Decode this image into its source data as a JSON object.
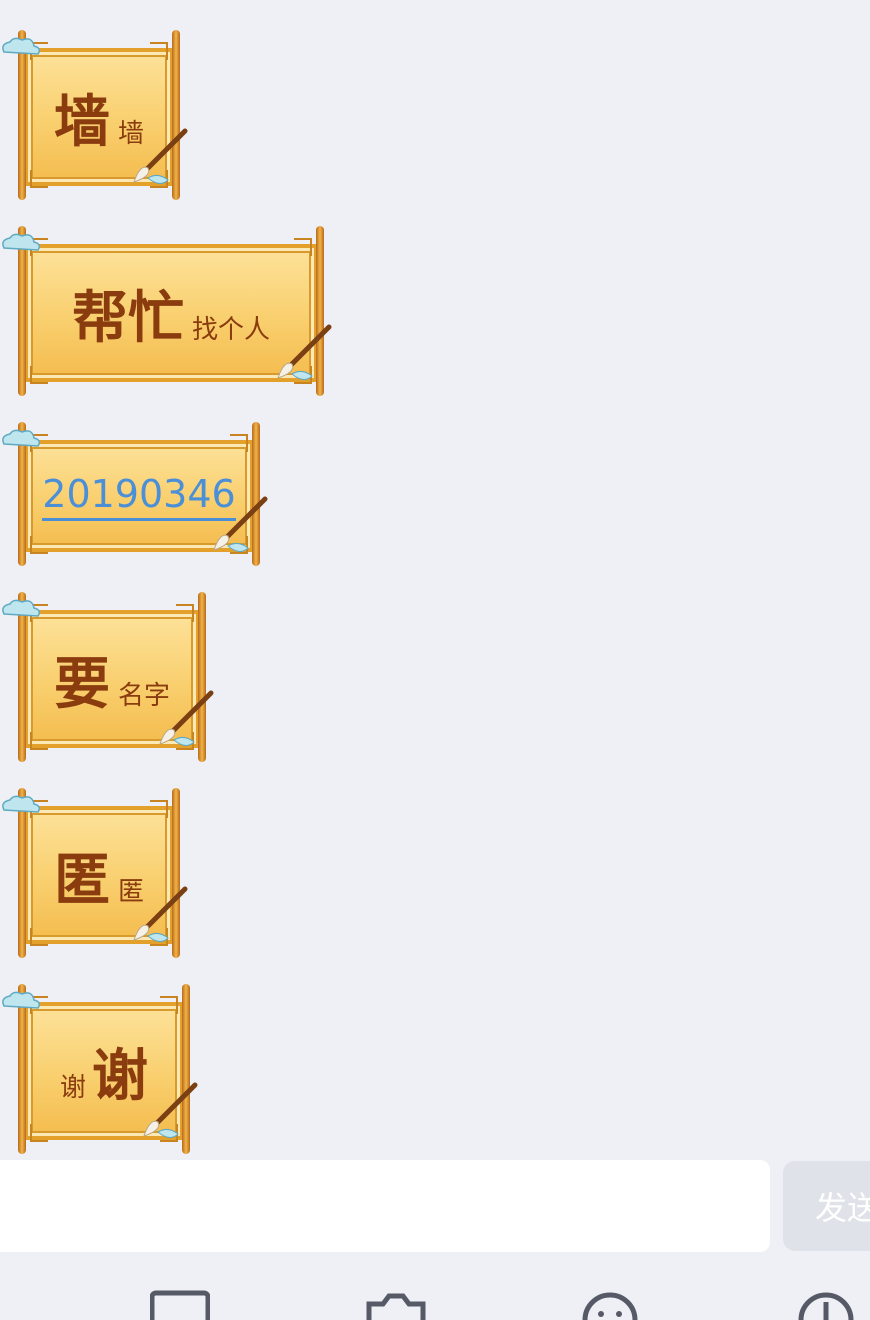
{
  "messages": [
    {
      "id": "m1",
      "big": "墙",
      "small": "墙",
      "small_position": "after"
    },
    {
      "id": "m2",
      "big": "帮忙",
      "small": "找个人",
      "small_position": "after"
    },
    {
      "id": "m3",
      "link": "20190346"
    },
    {
      "id": "m4",
      "big": "要",
      "small": "名字",
      "small_position": "after"
    },
    {
      "id": "m5",
      "big": "匿",
      "small": "匿",
      "small_position": "after"
    },
    {
      "id": "m6",
      "big": "谢",
      "small": "谢",
      "small_position": "before"
    }
  ],
  "composer": {
    "input_value": "",
    "send_label": "发送"
  },
  "toolbar": {
    "icons": [
      "image-icon",
      "camera-icon",
      "emoji-icon",
      "more-icon"
    ]
  },
  "colors": {
    "background": "#eef0f5",
    "scroll_fill": "#f9cf6e",
    "scroll_border": "#e3a02a",
    "ink": "#8a3c0f",
    "link": "#4a8fd8"
  }
}
